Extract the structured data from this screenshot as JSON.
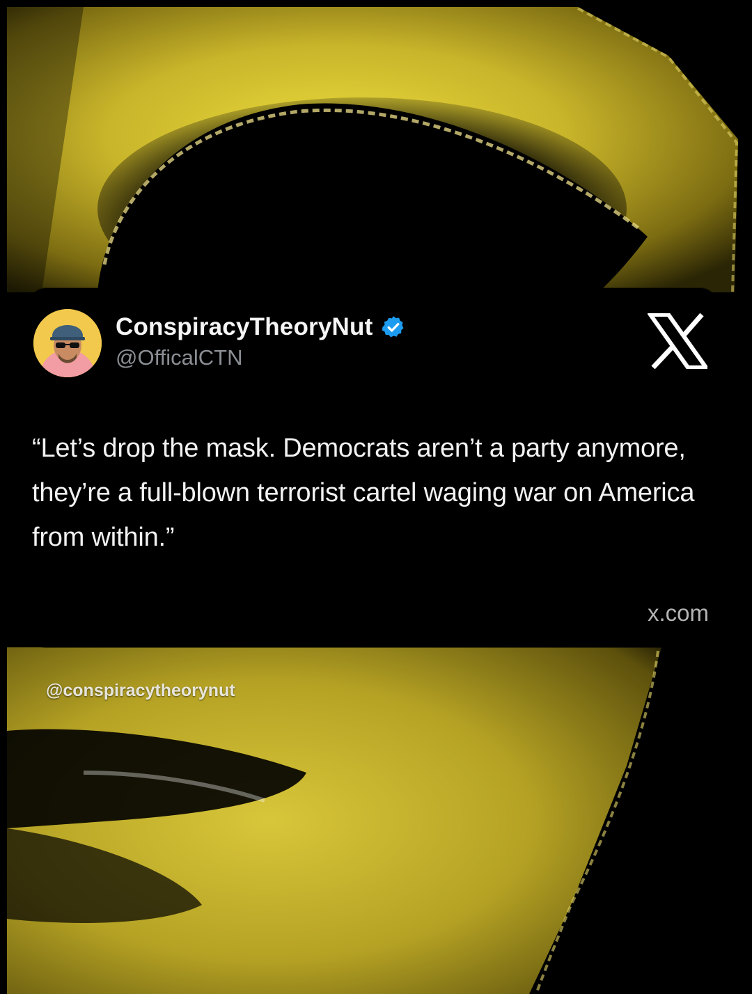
{
  "post": {
    "display_name": "ConspiracyTheoryNut",
    "handle": "@OfficalCTN",
    "verified": true,
    "text": "“Let’s drop the mask. Democrats aren’t a party anymore, they’re a full-blown terrorist cartel waging war on America from within.”",
    "source": "x.com"
  },
  "watermark": "@conspiracytheorynut",
  "icons": {
    "avatar": "user-avatar-icon",
    "verified": "verified-badge-icon",
    "platform": "x-logo-icon"
  },
  "colors": {
    "background": "#000000",
    "mask_gold": "#c9b52a",
    "verified_blue": "#1d9bf0",
    "handle_gray": "#8b8f94"
  }
}
